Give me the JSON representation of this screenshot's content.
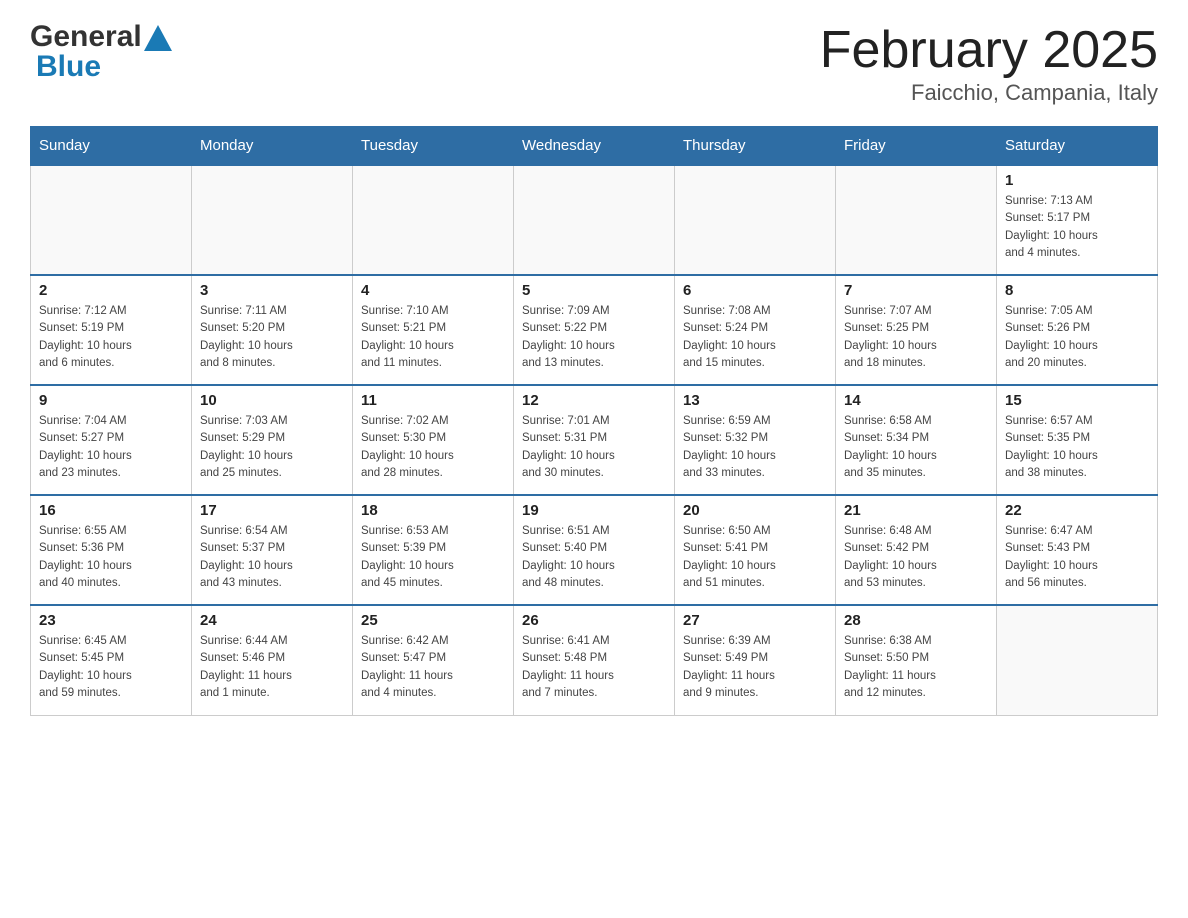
{
  "header": {
    "logo": {
      "general": "General",
      "blue": "Blue"
    },
    "title": "February 2025",
    "subtitle": "Faicchio, Campania, Italy"
  },
  "days_of_week": [
    "Sunday",
    "Monday",
    "Tuesday",
    "Wednesday",
    "Thursday",
    "Friday",
    "Saturday"
  ],
  "weeks": [
    {
      "days": [
        {
          "number": "",
          "info": ""
        },
        {
          "number": "",
          "info": ""
        },
        {
          "number": "",
          "info": ""
        },
        {
          "number": "",
          "info": ""
        },
        {
          "number": "",
          "info": ""
        },
        {
          "number": "",
          "info": ""
        },
        {
          "number": "1",
          "info": "Sunrise: 7:13 AM\nSunset: 5:17 PM\nDaylight: 10 hours\nand 4 minutes."
        }
      ]
    },
    {
      "days": [
        {
          "number": "2",
          "info": "Sunrise: 7:12 AM\nSunset: 5:19 PM\nDaylight: 10 hours\nand 6 minutes."
        },
        {
          "number": "3",
          "info": "Sunrise: 7:11 AM\nSunset: 5:20 PM\nDaylight: 10 hours\nand 8 minutes."
        },
        {
          "number": "4",
          "info": "Sunrise: 7:10 AM\nSunset: 5:21 PM\nDaylight: 10 hours\nand 11 minutes."
        },
        {
          "number": "5",
          "info": "Sunrise: 7:09 AM\nSunset: 5:22 PM\nDaylight: 10 hours\nand 13 minutes."
        },
        {
          "number": "6",
          "info": "Sunrise: 7:08 AM\nSunset: 5:24 PM\nDaylight: 10 hours\nand 15 minutes."
        },
        {
          "number": "7",
          "info": "Sunrise: 7:07 AM\nSunset: 5:25 PM\nDaylight: 10 hours\nand 18 minutes."
        },
        {
          "number": "8",
          "info": "Sunrise: 7:05 AM\nSunset: 5:26 PM\nDaylight: 10 hours\nand 20 minutes."
        }
      ]
    },
    {
      "days": [
        {
          "number": "9",
          "info": "Sunrise: 7:04 AM\nSunset: 5:27 PM\nDaylight: 10 hours\nand 23 minutes."
        },
        {
          "number": "10",
          "info": "Sunrise: 7:03 AM\nSunset: 5:29 PM\nDaylight: 10 hours\nand 25 minutes."
        },
        {
          "number": "11",
          "info": "Sunrise: 7:02 AM\nSunset: 5:30 PM\nDaylight: 10 hours\nand 28 minutes."
        },
        {
          "number": "12",
          "info": "Sunrise: 7:01 AM\nSunset: 5:31 PM\nDaylight: 10 hours\nand 30 minutes."
        },
        {
          "number": "13",
          "info": "Sunrise: 6:59 AM\nSunset: 5:32 PM\nDaylight: 10 hours\nand 33 minutes."
        },
        {
          "number": "14",
          "info": "Sunrise: 6:58 AM\nSunset: 5:34 PM\nDaylight: 10 hours\nand 35 minutes."
        },
        {
          "number": "15",
          "info": "Sunrise: 6:57 AM\nSunset: 5:35 PM\nDaylight: 10 hours\nand 38 minutes."
        }
      ]
    },
    {
      "days": [
        {
          "number": "16",
          "info": "Sunrise: 6:55 AM\nSunset: 5:36 PM\nDaylight: 10 hours\nand 40 minutes."
        },
        {
          "number": "17",
          "info": "Sunrise: 6:54 AM\nSunset: 5:37 PM\nDaylight: 10 hours\nand 43 minutes."
        },
        {
          "number": "18",
          "info": "Sunrise: 6:53 AM\nSunset: 5:39 PM\nDaylight: 10 hours\nand 45 minutes."
        },
        {
          "number": "19",
          "info": "Sunrise: 6:51 AM\nSunset: 5:40 PM\nDaylight: 10 hours\nand 48 minutes."
        },
        {
          "number": "20",
          "info": "Sunrise: 6:50 AM\nSunset: 5:41 PM\nDaylight: 10 hours\nand 51 minutes."
        },
        {
          "number": "21",
          "info": "Sunrise: 6:48 AM\nSunset: 5:42 PM\nDaylight: 10 hours\nand 53 minutes."
        },
        {
          "number": "22",
          "info": "Sunrise: 6:47 AM\nSunset: 5:43 PM\nDaylight: 10 hours\nand 56 minutes."
        }
      ]
    },
    {
      "days": [
        {
          "number": "23",
          "info": "Sunrise: 6:45 AM\nSunset: 5:45 PM\nDaylight: 10 hours\nand 59 minutes."
        },
        {
          "number": "24",
          "info": "Sunrise: 6:44 AM\nSunset: 5:46 PM\nDaylight: 11 hours\nand 1 minute."
        },
        {
          "number": "25",
          "info": "Sunrise: 6:42 AM\nSunset: 5:47 PM\nDaylight: 11 hours\nand 4 minutes."
        },
        {
          "number": "26",
          "info": "Sunrise: 6:41 AM\nSunset: 5:48 PM\nDaylight: 11 hours\nand 7 minutes."
        },
        {
          "number": "27",
          "info": "Sunrise: 6:39 AM\nSunset: 5:49 PM\nDaylight: 11 hours\nand 9 minutes."
        },
        {
          "number": "28",
          "info": "Sunrise: 6:38 AM\nSunset: 5:50 PM\nDaylight: 11 hours\nand 12 minutes."
        },
        {
          "number": "",
          "info": ""
        }
      ]
    }
  ]
}
